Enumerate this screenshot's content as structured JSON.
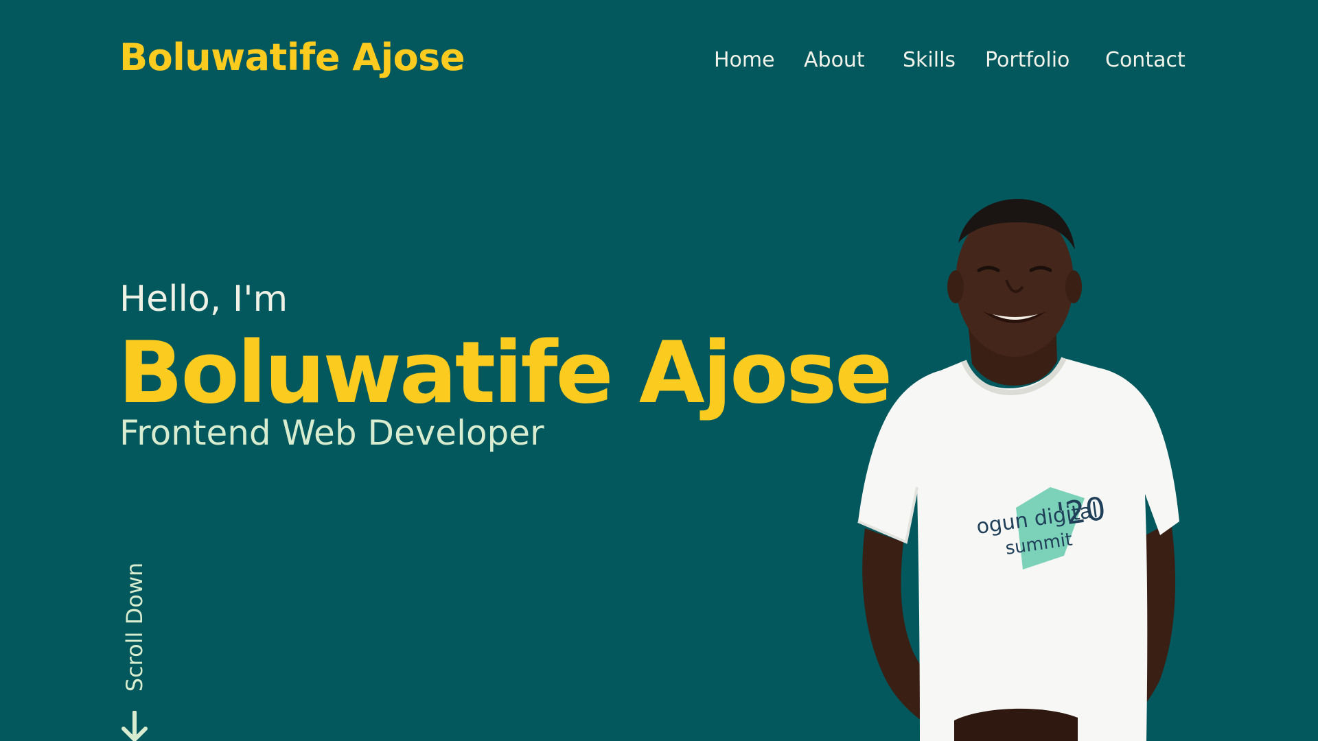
{
  "header": {
    "brand": "Boluwatife Ajose"
  },
  "nav": {
    "items": [
      {
        "label": "Home"
      },
      {
        "label": "About"
      },
      {
        "label": "Skills"
      },
      {
        "label": "Portfolio"
      },
      {
        "label": "Contact"
      }
    ]
  },
  "hero": {
    "greeting": "Hello, I'm",
    "name": "Boluwatife Ajose",
    "role": "Frontend Web Developer",
    "scroll_label": "Scroll Down",
    "shirt_text": {
      "line1": "ogun digital",
      "line2": "summit",
      "year": "'20"
    }
  },
  "theme": {
    "background": "#02585c",
    "accent": "#fccb1f",
    "text_light": "#eef1e6",
    "text_soft": "#d8ecd0"
  },
  "icons": {
    "scroll": "arrow-down-icon",
    "portrait": "profile-photo"
  }
}
